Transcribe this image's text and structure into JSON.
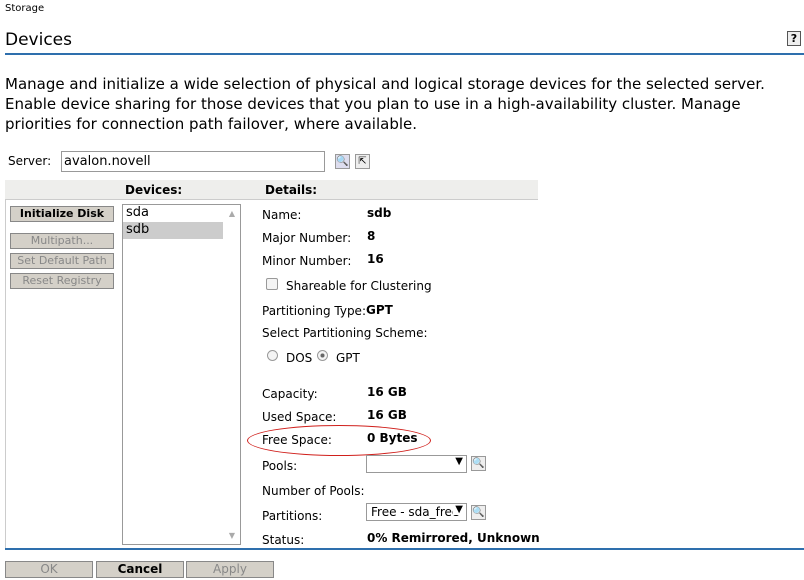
{
  "breadcrumb": "Storage",
  "page_title": "Devices",
  "help_label": "?",
  "description": "Manage and initialize a wide selection of physical and logical storage devices for the selected server. Enable device sharing for those devices that you plan to use in a high-availability cluster. Manage priorities for connection path failover, where available.",
  "server": {
    "label": "Server:",
    "value": "avalon.novell"
  },
  "headers": {
    "devices": "Devices:",
    "details": "Details:"
  },
  "actions": {
    "initialize": "Initialize Disk",
    "multipath": "Multipath...",
    "default_path": "Set Default Path",
    "reset": "Reset Registry"
  },
  "devices": [
    "sda",
    "sdb"
  ],
  "details": {
    "name_label": "Name:",
    "name": "sdb",
    "major_label": "Major Number:",
    "major": "8",
    "minor_label": "Minor Number:",
    "minor": "16",
    "shareable": "Shareable for Clustering",
    "ptype_label": "Partitioning Type:",
    "ptype": "GPT",
    "scheme_label": "Select Partitioning Scheme:",
    "dos": "DOS",
    "gpt": "GPT",
    "capacity_label": "Capacity:",
    "capacity": "16 GB",
    "used_label": "Used Space:",
    "used": "16 GB",
    "free_label": "Free Space:",
    "free": "0 Bytes",
    "pools_label": "Pools:",
    "pools_value": "",
    "npools_label": "Number of Pools:",
    "partitions_label": "Partitions:",
    "partitions_value": "Free - sda_free",
    "status_label": "Status:",
    "status": "0% Remirrored, Unknown"
  },
  "footer": {
    "ok": "OK",
    "cancel": "Cancel",
    "apply": "Apply"
  },
  "colors": {
    "accent": "#2e6fad",
    "highlight": "#d0201c"
  }
}
